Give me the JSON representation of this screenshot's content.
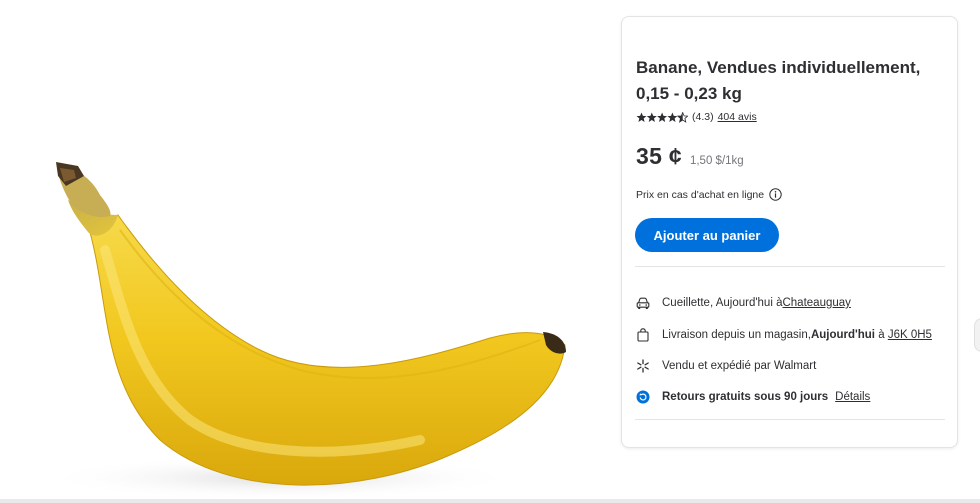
{
  "product": {
    "title": "Banane, Vendues individuellement, 0,15 - 0,23 kg",
    "rating": {
      "value_text": "(4.3)",
      "stars": 4.3,
      "reviews_label": "404 avis"
    },
    "price": "35 ¢",
    "unit_price": "1,50 $/1kg",
    "online_price_note": "Prix en cas d'achat en ligne",
    "add_to_cart_label": "Ajouter au panier"
  },
  "fulfillment": {
    "pickup": {
      "prefix": "Cueillette, Aujourd'hui à ",
      "store_link": "Chateauguay"
    },
    "delivery": {
      "prefix": "Livraison depuis un magasin, ",
      "day": "Aujourd'hui",
      "middle": " à ",
      "postal_link": "J6K 0H5"
    },
    "seller": {
      "text": "Vendu et expédié par Walmart"
    },
    "returns": {
      "text": "Retours gratuits sous 90 jours",
      "details_link": "Détails"
    }
  },
  "colors": {
    "accent": "#0071dc",
    "text": "#2e2f32",
    "muted": "#74767c",
    "banana_yellow": "#f2c81f"
  },
  "icons": [
    "star-icon",
    "info-icon",
    "car-icon",
    "bag-icon",
    "walmart-spark-icon",
    "return-icon"
  ]
}
